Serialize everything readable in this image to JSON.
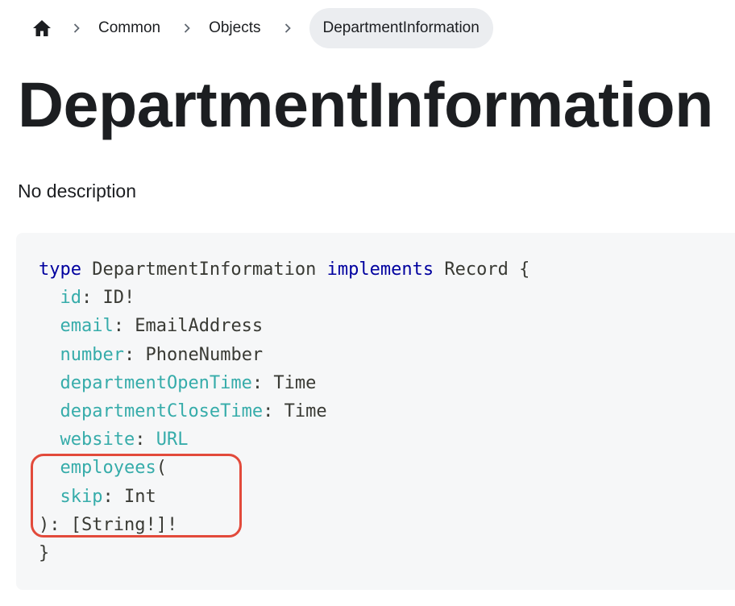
{
  "breadcrumb": {
    "home_icon": "home-icon",
    "separator_icon": "chevron-right-icon",
    "items": [
      "Common",
      "Objects"
    ],
    "current": "DepartmentInformation"
  },
  "page": {
    "title": "DepartmentInformation",
    "description": "No description"
  },
  "code": {
    "type_keyword": "type",
    "type_name": "DepartmentInformation",
    "implements_keyword": "implements",
    "interface": "Record",
    "open_brace": "{",
    "close_brace": "}",
    "fields": [
      {
        "name": "id",
        "type": "ID!"
      },
      {
        "name": "email",
        "type": "EmailAddress"
      },
      {
        "name": "number",
        "type": "PhoneNumber"
      },
      {
        "name": "departmentOpenTime",
        "type": "Time"
      },
      {
        "name": "departmentCloseTime",
        "type": "Time"
      },
      {
        "name": "website",
        "type": "URL"
      }
    ],
    "employees_field": {
      "name": "employees",
      "open_paren": "(",
      "arg_name": "skip",
      "arg_type": "Int",
      "return": "): [String!]!"
    }
  },
  "colors": {
    "keyword": "#00009f",
    "field": "#36acaa",
    "highlight": "#e24a3b",
    "code_background": "#f6f7f8",
    "breadcrumb_active_bg": "#ebedf0"
  }
}
